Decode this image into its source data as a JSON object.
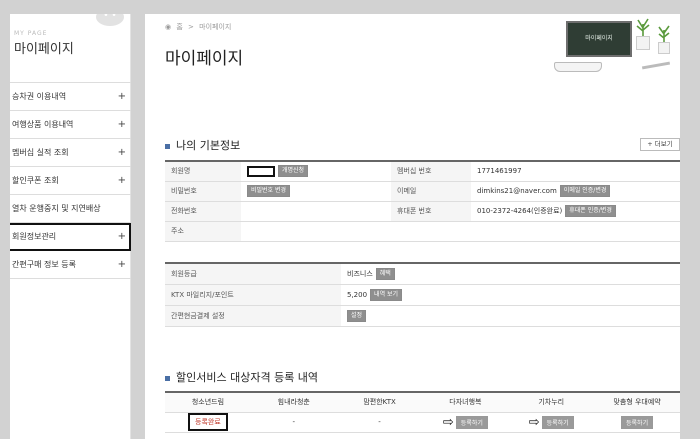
{
  "sidebar": {
    "subtitle": "MY PAGE",
    "title": "마이페이지",
    "items": [
      {
        "label": "승차권 이용내역"
      },
      {
        "label": "여행상품 이용내역"
      },
      {
        "label": "멤버십 실적 조회"
      },
      {
        "label": "할인쿠폰 조회"
      },
      {
        "label": "열차 운행중지 및 지연배상"
      },
      {
        "label": "회원정보관리"
      },
      {
        "label": "간편구매 정보 등록"
      }
    ],
    "plus": "+"
  },
  "breadcrumb": {
    "home": "홈",
    "sep": ">",
    "current": "마이페이지"
  },
  "page_title": "마이페이지",
  "board_text": "마이페이지",
  "basic": {
    "title": "나의 기본정보",
    "more": "+ 더보기",
    "member_name_label": "회원명",
    "rename_btn": "개명신청",
    "membership_no_label": "멤버십 번호",
    "membership_no": "1771461997",
    "password_label": "비밀번호",
    "password_btn": "비밀번호 변경",
    "email_label": "이메일",
    "email": "dimkins21@naver.com",
    "email_btn": "이메일 인증/변경",
    "phone_label": "전화번호",
    "mobile_label": "휴대폰 번호",
    "mobile": "010-2372-4264(인증완료)",
    "mobile_btn": "휴대폰 인증/변경",
    "address_label": "주소"
  },
  "grade": {
    "grade_label": "회원등급",
    "grade_value": "비즈니스",
    "grade_btn": "혜택",
    "mileage_label": "KTX 마일리지/포인트",
    "mileage_value": "5,200",
    "mileage_btn": "내역 보기",
    "simplepay_label": "간편현금결제 설정",
    "simplepay_btn": "설정"
  },
  "discount": {
    "title": "할인서비스 대상자격 등록 내역",
    "headers": [
      "청소년드림",
      "힘내라청춘",
      "맘편한KTX",
      "다자녀행복",
      "기차누리",
      "맞춤형 우대예약"
    ],
    "youth_status": "등록완료",
    "dash": "-",
    "register_btn": "등록하기",
    "arrow": "⇨"
  },
  "colors": {
    "accent": "#4a6fa5",
    "done": "#c0392b"
  }
}
